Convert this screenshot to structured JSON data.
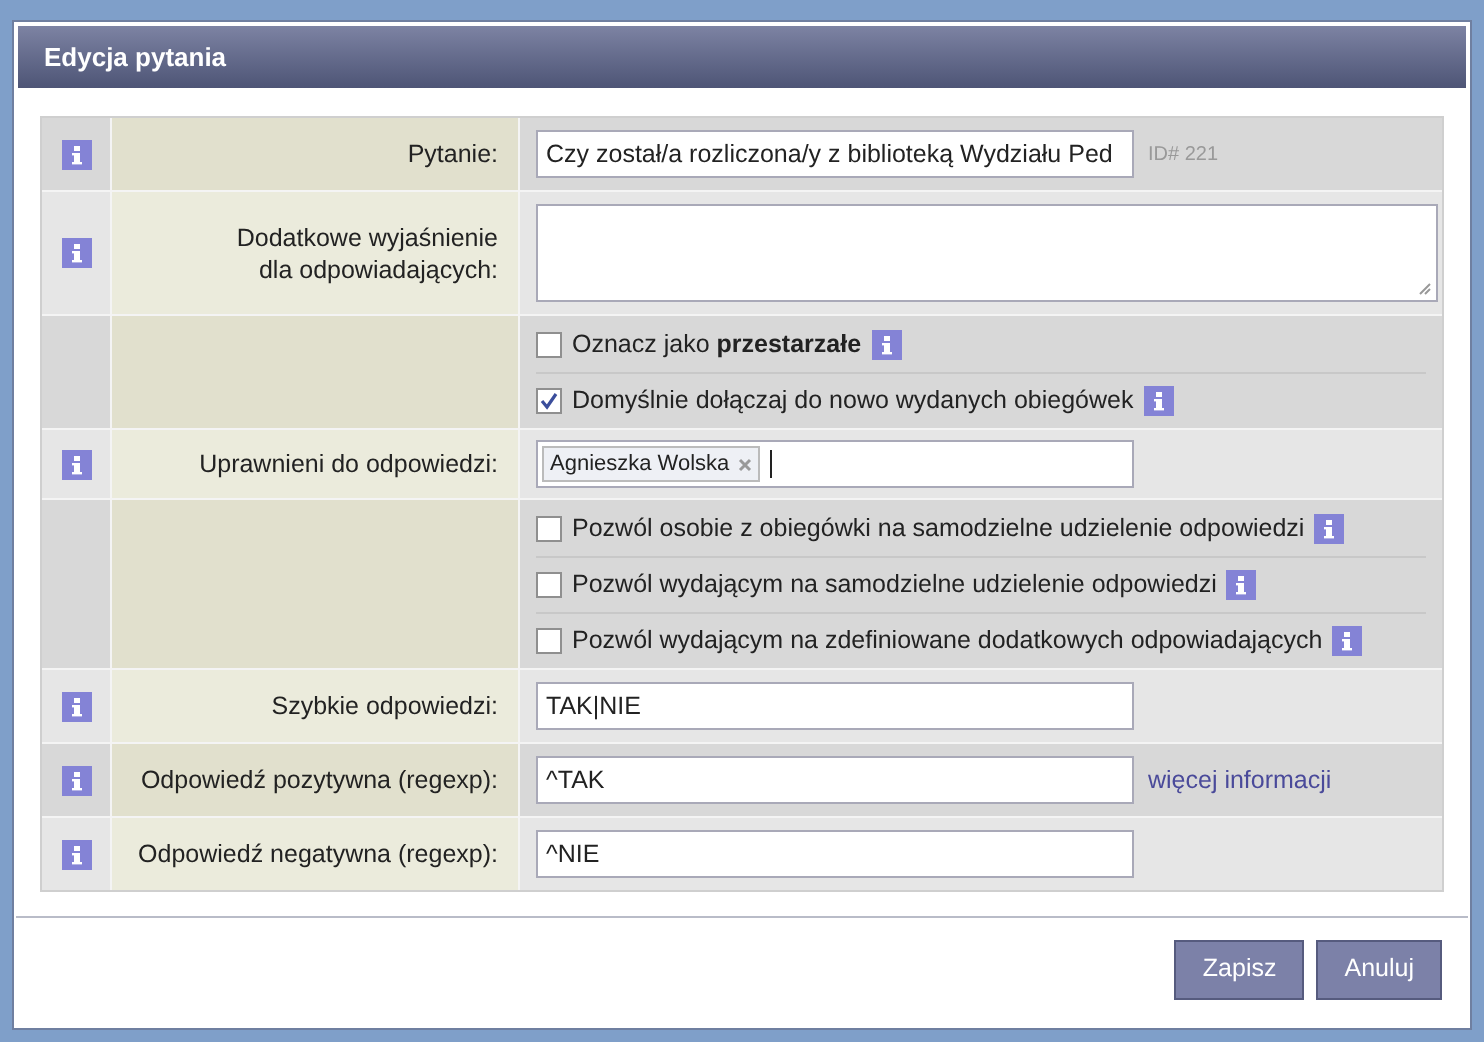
{
  "dialog": {
    "title": "Edycja pytania"
  },
  "rows": [
    {
      "kind": "text",
      "info": true,
      "label": [
        "Pytanie:"
      ],
      "value": "Czy został/a rozliczona/y z biblioteką Wydziału Ped",
      "note": "ID# 221"
    },
    {
      "kind": "textarea",
      "info": true,
      "label": [
        "Dodatkowe wyjaśnienie",
        "dla odpowiadających:"
      ]
    },
    {
      "kind": "checkboxes",
      "info": false,
      "options": [
        {
          "label": "Oznacz jako **przestarzałe**",
          "checked": false
        },
        {
          "label": "Domyślnie dołączaj do nowo wydanych obiegówek",
          "checked": true
        }
      ]
    },
    {
      "kind": "tags",
      "info": true,
      "label": [
        "Uprawnieni do odpowiedzi:"
      ],
      "tags": [
        "Agnieszka Wolska"
      ]
    },
    {
      "kind": "checkboxes",
      "info": false,
      "options": [
        {
          "label": "Pozwól osobie z obiegówki na samodzielne udzielenie odpowiedzi",
          "checked": false
        },
        {
          "label": "Pozwól wydającym na samodzielne udzielenie odpowiedzi",
          "checked": false
        },
        {
          "label": "Pozwól wydającym na zdefiniowane dodatkowych odpowiadających",
          "checked": false
        }
      ]
    },
    {
      "kind": "text",
      "info": true,
      "label": [
        "Szybkie odpowiedzi:"
      ],
      "value": "TAK|NIE"
    },
    {
      "kind": "text",
      "info": true,
      "label": [
        "Odpowiedź pozytywna (regexp):"
      ],
      "value": "^TAK",
      "link": "więcej informacji"
    },
    {
      "kind": "text",
      "info": true,
      "label": [
        "Odpowiedź negatywna (regexp):"
      ],
      "value": "^NIE"
    }
  ],
  "buttons": [
    "Zapisz",
    "Anuluj"
  ]
}
